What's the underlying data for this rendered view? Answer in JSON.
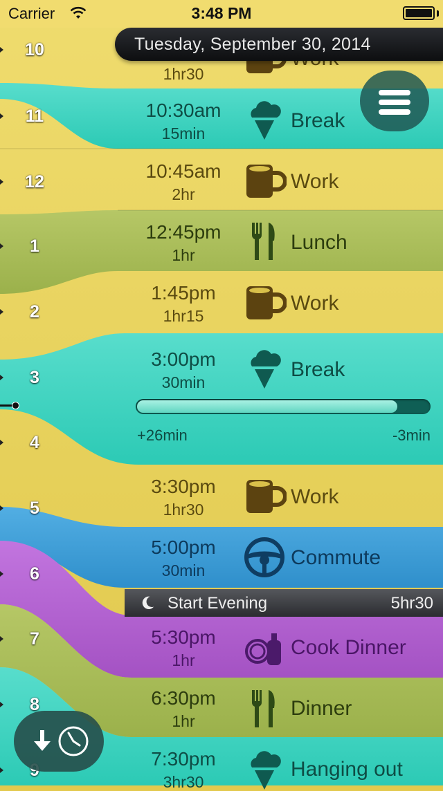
{
  "status_bar": {
    "carrier": "Carrier",
    "time": "3:48 PM"
  },
  "header": {
    "date": "Tuesday, September 30, 2014"
  },
  "colors": {
    "work": "#e5cf55",
    "break": "#3fd3c0",
    "lunch": "#a8bd55",
    "commute": "#3e9dd6",
    "evening": "#b15fcf",
    "dinner": "#a8bd55"
  },
  "hours": [
    "10",
    "11",
    "12",
    "1",
    "2",
    "3",
    "4",
    "5",
    "6",
    "7",
    "8",
    "9"
  ],
  "events": [
    {
      "time": "",
      "duration": "1hr30",
      "name": "Work",
      "icon": "coffee-mug-icon"
    },
    {
      "time": "10:30am",
      "duration": "15min",
      "name": "Break",
      "icon": "ice-cream-icon"
    },
    {
      "time": "10:45am",
      "duration": "2hr",
      "name": "Work",
      "icon": "coffee-mug-icon"
    },
    {
      "time": "12:45pm",
      "duration": "1hr",
      "name": "Lunch",
      "icon": "fork-knife-icon"
    },
    {
      "time": "1:45pm",
      "duration": "1hr15",
      "name": "Work",
      "icon": "coffee-mug-icon"
    },
    {
      "time": "3:00pm",
      "duration": "30min",
      "name": "Break",
      "icon": "ice-cream-icon"
    },
    {
      "time": "3:30pm",
      "duration": "1hr30",
      "name": "Work",
      "icon": "coffee-mug-icon"
    },
    {
      "time": "5:00pm",
      "duration": "30min",
      "name": "Commute",
      "icon": "steering-wheel-icon"
    },
    {
      "time": "5:30pm",
      "duration": "1hr",
      "name": "Cook Dinner",
      "icon": "dishes-icon"
    },
    {
      "time": "6:30pm",
      "duration": "1hr",
      "name": "Dinner",
      "icon": "fork-knife-icon"
    },
    {
      "time": "7:30pm",
      "duration": "3hr30",
      "name": "Hanging out",
      "icon": "ice-cream-icon"
    }
  ],
  "current_progress": {
    "fraction": 0.89,
    "elapsed": "+26min",
    "remaining": "-3min"
  },
  "evening_divider": {
    "label": "Start Evening",
    "duration": "5hr30",
    "icon": "moon-icon"
  }
}
